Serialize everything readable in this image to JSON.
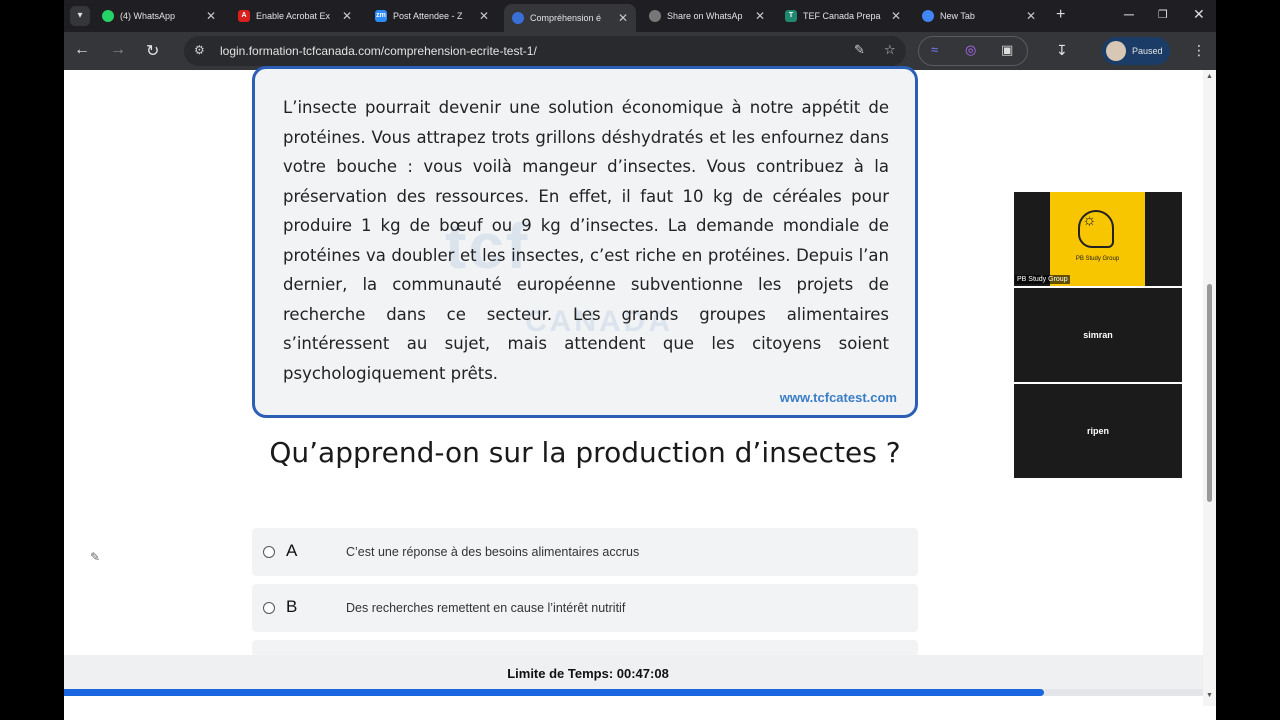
{
  "browser": {
    "tabs": [
      {
        "label": "(4) WhatsApp",
        "icon": "whatsapp-icon",
        "color": "#25d366"
      },
      {
        "label": "Enable Acrobat Ex",
        "icon": "acrobat-icon",
        "color": "#d9201e"
      },
      {
        "label": "Post Attendee - Z",
        "icon": "zoom-icon",
        "color": "#2d8cff"
      },
      {
        "label": "Compréhension é",
        "icon": "tcf-icon",
        "color": "#3a6fd8"
      },
      {
        "label": "Share on WhatsAp",
        "icon": "globe-icon",
        "color": "#777"
      },
      {
        "label": "TEF Canada Prepa",
        "icon": "tef-icon",
        "color": "#1f8a70"
      },
      {
        "label": "New Tab",
        "icon": "chrome-icon",
        "color": "#4285f4"
      }
    ],
    "url": "login.formation-tcfcanada.com/comprehension-ecrite-test-1/",
    "profile_status": "Paused"
  },
  "passage": {
    "text": "L’insecte pourrait devenir une solution économique à notre appétit de protéines. Vous attrapez trots grillons déshydratés et les enfournez dans votre bouche : vous voilà mangeur d’insectes. Vous contribuez à la préservation des ressources. En effet, il faut 10 kg de céréales pour produire 1 kg de bœuf ou 9 kg d’insectes. La demande mondiale de protéines va doubler et les insectes, c’est riche en protéines. Depuis l’an dernier, la communauté européenne subventionne les projets de recherche dans ce secteur. Les grands groupes alimentaires s’intéressent au sujet, mais attendent que les citoyens soient psychologiquement prêts.",
    "watermark": "tcf",
    "watermark_sub": "CANADA",
    "site": "www.tcfcatest.com"
  },
  "question": "Qu’apprend-on sur la production d’insectes ?",
  "options": [
    {
      "letter": "A",
      "text": "C’est une réponse à des besoins alimentaires accrus"
    },
    {
      "letter": "B",
      "text": "Des recherches remettent en cause l’intérêt nutritif"
    }
  ],
  "timer": {
    "label": "Limite de Temps: 00:47:08",
    "progress_fraction": 0.86
  },
  "video": {
    "participants": [
      {
        "name": "PB Study Group",
        "image_caption": "PB Study Group"
      },
      {
        "name": "simran"
      },
      {
        "name": "ripen"
      }
    ]
  }
}
